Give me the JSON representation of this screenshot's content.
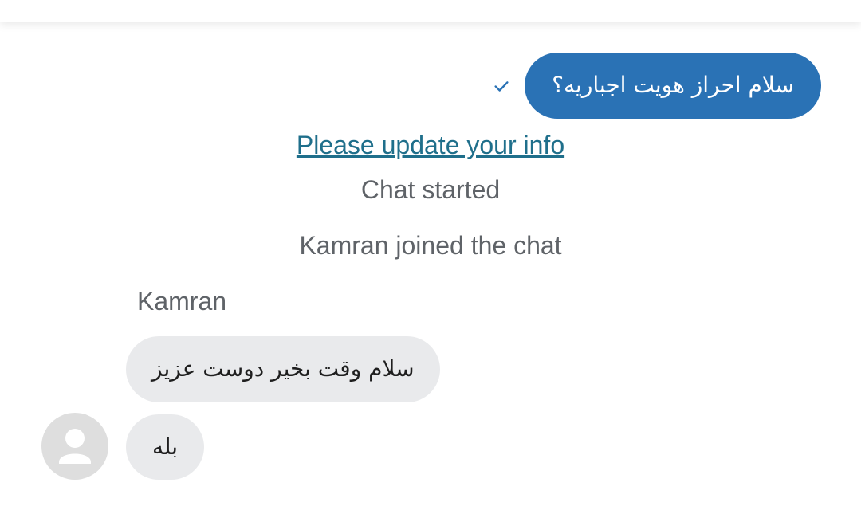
{
  "sent_message": {
    "text": "سلام احراز هویت اجباریه؟",
    "status_icon": "check-icon",
    "bubble_color": "#2a72b5"
  },
  "system_link": {
    "text": "Please update your info",
    "color": "#1f6f8b"
  },
  "system_messages": [
    "Chat started",
    "Kamran joined the chat"
  ],
  "agent": {
    "name": "Kamran",
    "avatar_icon": "user-placeholder-icon",
    "messages": [
      "سلام وقت بخیر دوست عزیز",
      "بله"
    ]
  }
}
